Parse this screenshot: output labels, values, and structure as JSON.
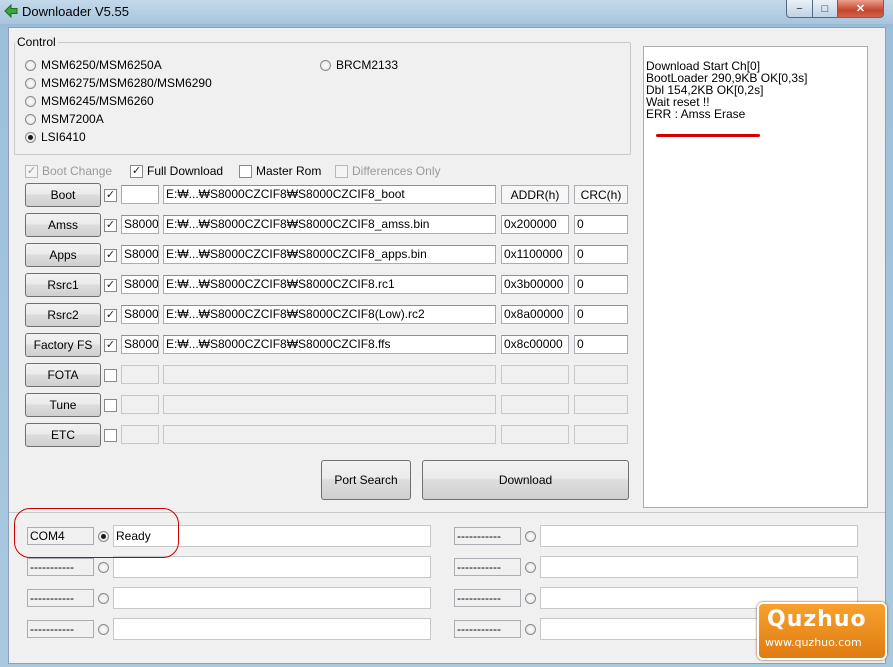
{
  "window": {
    "title": "Downloader V5.55",
    "accent_color": "#a7c5dd",
    "controls": {
      "minimize": "−",
      "maximize": "□",
      "close": "✕"
    }
  },
  "control": {
    "legend": "Control",
    "chips": [
      {
        "label": "MSM6250/MSM6250A",
        "selected": false
      },
      {
        "label": "MSM6275/MSM6280/MSM6290",
        "selected": false
      },
      {
        "label": "MSM6245/MSM6260",
        "selected": false
      },
      {
        "label": "MSM7200A",
        "selected": false
      },
      {
        "label": "LSI6410",
        "selected": true
      },
      {
        "label": "BRCM2133",
        "selected": false
      }
    ]
  },
  "options": {
    "boot_change": {
      "label": "Boot Change",
      "checked": true,
      "disabled": true
    },
    "full_download": {
      "label": "Full Download",
      "checked": true
    },
    "master_rom": {
      "label": "Master Rom",
      "checked": false
    },
    "differences_only": {
      "label": "Differences Only",
      "checked": false,
      "disabled": true
    }
  },
  "table": {
    "addr_header": "ADDR(h)",
    "crc_header": "CRC(h)",
    "rows": [
      {
        "button": "Boot",
        "checked": true,
        "model": "",
        "path": "E:₩...₩S8000CZCIF8₩S8000CZCIF8_boot",
        "addr": "",
        "crc": ""
      },
      {
        "button": "Amss",
        "checked": true,
        "model": "S8000",
        "path": "E:₩...₩S8000CZCIF8₩S8000CZCIF8_amss.bin",
        "addr": "0x200000",
        "crc": "0"
      },
      {
        "button": "Apps",
        "checked": true,
        "model": "S8000",
        "path": "E:₩...₩S8000CZCIF8₩S8000CZCIF8_apps.bin",
        "addr": "0x1100000",
        "crc": "0"
      },
      {
        "button": "Rsrc1",
        "checked": true,
        "model": "S8000",
        "path": "E:₩...₩S8000CZCIF8₩S8000CZCIF8.rc1",
        "addr": "0x3b00000",
        "crc": "0"
      },
      {
        "button": "Rsrc2",
        "checked": true,
        "model": "S8000",
        "path": "E:₩...₩S8000CZCIF8₩S8000CZCIF8(Low).rc2",
        "addr": "0x8a00000",
        "crc": "0"
      },
      {
        "button": "Factory FS",
        "checked": true,
        "model": "S8000",
        "path": "E:₩...₩S8000CZCIF8₩S8000CZCIF8.ffs",
        "addr": "0x8c00000",
        "crc": "0"
      },
      {
        "button": "FOTA",
        "checked": false,
        "model": "",
        "path": "",
        "addr": "",
        "crc": ""
      },
      {
        "button": "Tune",
        "checked": false,
        "model": "",
        "path": "",
        "addr": "",
        "crc": ""
      },
      {
        "button": "ETC",
        "checked": false,
        "model": "",
        "path": "",
        "addr": "",
        "crc": ""
      }
    ]
  },
  "actions": {
    "port_search": "Port Search",
    "download": "Download"
  },
  "log": {
    "lines": [
      "Download Start Ch[0]",
      "BootLoader 290,9KB OK[0,3s]",
      "Dbl 154,2KB OK[0,2s]",
      "Wait reset !!",
      "ERR : Amss Erase"
    ]
  },
  "ports": [
    {
      "name": "COM4",
      "status": "Ready",
      "selected": true
    },
    {
      "name": "-----------",
      "status": "",
      "selected": false
    },
    {
      "name": "-----------",
      "status": "",
      "selected": false
    },
    {
      "name": "-----------",
      "status": "",
      "selected": false
    },
    {
      "name": "-----------",
      "status": "",
      "selected": false
    },
    {
      "name": "-----------",
      "status": "",
      "selected": false
    },
    {
      "name": "-----------",
      "status": "",
      "selected": false
    },
    {
      "name": "-----------",
      "status": "",
      "selected": false
    }
  ],
  "watermark": {
    "logo": "Quzhuo",
    "url": "www.quzhuo.com"
  }
}
